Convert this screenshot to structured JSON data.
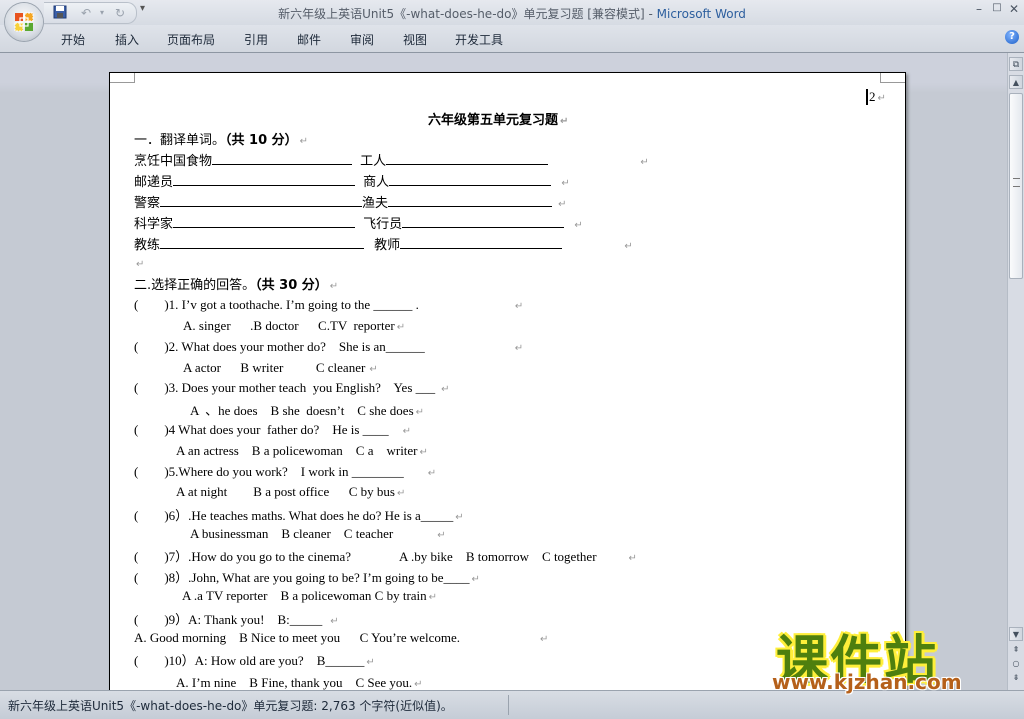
{
  "window": {
    "title_doc": "新六年级上英语Unit5《-what-does-he-do》单元复习题 [兼容模式]",
    "title_sep": " - ",
    "title_app": "Microsoft Word",
    "minimize": "–",
    "restore": "□",
    "close": "✕"
  },
  "qat": {
    "save_icon": "floppy-disk",
    "undo_icon": "undo-arrow",
    "redo_icon": "redo-arrow",
    "more": "▾"
  },
  "ribbon": {
    "tabs": [
      "开始",
      "插入",
      "页面布局",
      "引用",
      "邮件",
      "审阅",
      "视图",
      "开发工具"
    ],
    "help": "?"
  },
  "document": {
    "page_marker": "2",
    "title": "六年级第五单元复习题",
    "section1": {
      "heading_prefix": "一．翻译单词。",
      "heading_score": "（共 10 分）",
      "rows": [
        {
          "left": "烹饪中国食物",
          "right": "工人"
        },
        {
          "left": "邮递员",
          "right": "商人"
        },
        {
          "left": "警察",
          "right": "渔夫"
        },
        {
          "left": "科学家",
          "right": "飞行员"
        },
        {
          "left": "教练",
          "right": "教师"
        }
      ]
    },
    "section2": {
      "heading_prefix": "二.选择正确的回答。",
      "heading_score": "（共 30 分）",
      "lines": [
        {
          "paren": "(        )",
          "text": "1. I’v got a toothache. I’m going to the ______ ."
        },
        {
          "text": "A. singer      .B doctor      C.TV  reporter"
        },
        {
          "paren": "(        )",
          "text": "2. What does your mother do?    She is an______"
        },
        {
          "text": "A actor      B writer          C cleaner"
        },
        {
          "paren": "(        )",
          "text": "3. Does your mother teach  you English?    Yes ___"
        },
        {
          "text": "A  、he does    B she  doesn’t    C she does"
        },
        {
          "paren": "(        )",
          "text": "4 What does your  father do?    He is ____"
        },
        {
          "text": "A an actress    B a policewoman    C a    writer"
        },
        {
          "paren": "(        )",
          "text": "5.Where do you work?    I work in ________"
        },
        {
          "text": "A at night        B a post office      C by bus"
        },
        {
          "paren": "(        )",
          "text": "6）.He teaches maths. What does he do? He is a_____"
        },
        {
          "text": "A businessman    B cleaner    C teacher"
        },
        {
          "paren": "(        )",
          "text": "7）.How do you go to the cinema?               A .by bike    B tomorrow    C together"
        },
        {
          "paren": "(        )",
          "text": "8）.John, What are you going to be? I’m going to be____"
        },
        {
          "text": "A .a TV reporter    B a policewoman C by train"
        },
        {
          "paren": "(        )",
          "text": "9）A: Thank you!    B:_____"
        },
        {
          "text": "A. Good morning    B Nice to meet you      C You’re welcome."
        },
        {
          "paren": "(        )",
          "text": "10）A: How old are you?    B______"
        },
        {
          "text": "A. I’m nine    B Fine, thank you    C See you."
        }
      ]
    },
    "paragraph_mark": "↵"
  },
  "statusbar": {
    "text": "新六年级上英语Unit5《-what-does-he-do》单元复习题: 2,763 个字符(近似值)。"
  },
  "watermark": {
    "cn": "课件站",
    "url": "www.kjzhan.com"
  },
  "scrollbar": {
    "up": "▲",
    "down": "▼",
    "prev_page": "⇞",
    "browse_object": "○",
    "next_page": "⇟"
  }
}
